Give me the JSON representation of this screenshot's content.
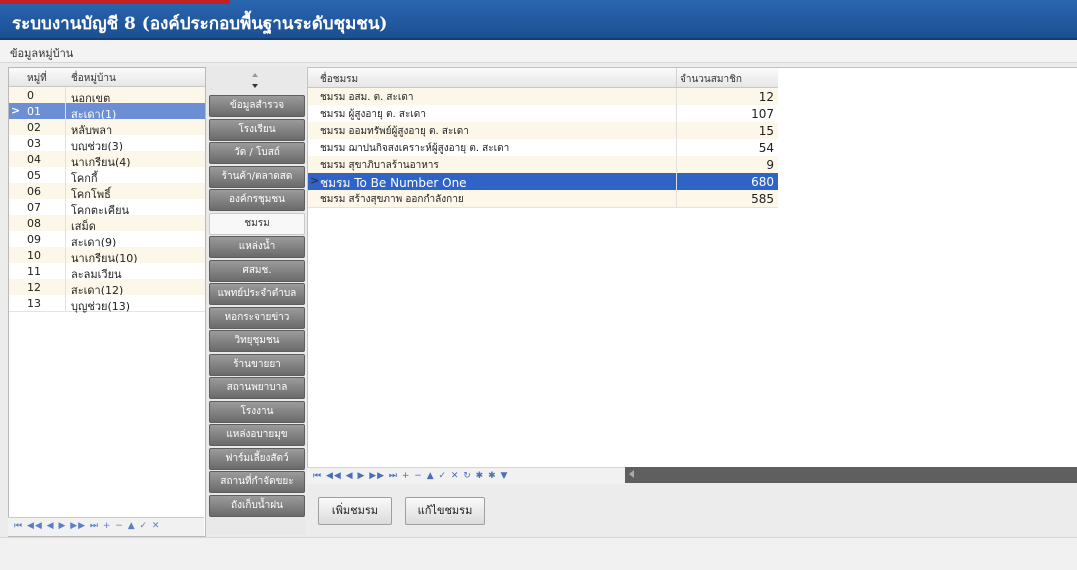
{
  "window": {
    "title": "ระบบงานบัญชี 8 (องค์ประกอบพื้นฐานระดับชุมชน)"
  },
  "menu": {
    "item": "ข้อมูลหมู่บ้าน"
  },
  "villages": {
    "col_no": "หมู่ที่",
    "col_name": "ชื่อหมู่บ้าน",
    "rows": [
      {
        "no": "0",
        "name": "นอกเขต"
      },
      {
        "no": "01",
        "name": "สะเดา(1)"
      },
      {
        "no": "02",
        "name": "หลับพลา"
      },
      {
        "no": "03",
        "name": "บุญช่วย(3)"
      },
      {
        "no": "04",
        "name": "นาเกรียน(4)"
      },
      {
        "no": "05",
        "name": "โคกกี้"
      },
      {
        "no": "06",
        "name": "โคกโพธิ์"
      },
      {
        "no": "07",
        "name": "โคกตะเคียน"
      },
      {
        "no": "08",
        "name": "เสม็ด"
      },
      {
        "no": "09",
        "name": "สะเดา(9)"
      },
      {
        "no": "10",
        "name": "นาเกรียน(10)"
      },
      {
        "no": "11",
        "name": "ละลมเวียน"
      },
      {
        "no": "12",
        "name": "สะเดา(12)"
      },
      {
        "no": "13",
        "name": "บุญช่วย(13)"
      }
    ],
    "selected_index": 1,
    "selected_pointer": ">",
    "nav": "⏮ ◀◀ ◀ ▶ ▶▶ ⏭ + − ▲ ✓ ✕"
  },
  "categories": [
    "ข้อมูลสำรวจ",
    "โรงเรียน",
    "วัด / โบสถ์",
    "ร้านค้า/ตลาดสด",
    "องค์กรชุมชน",
    "ชมรม",
    "แหล่งน้ำ",
    "ศสมช.",
    "แพทย์ประจำตำบล",
    "หอกระจายข่าว",
    "วิทยุชุมชน",
    "ร้านขายยา",
    "สถานพยาบาล",
    "โรงงาน",
    "แหล่งอบายมุข",
    "ฟาร์มเลี้ยงสัตว์",
    "สถานที่กำจัดขยะ",
    "ถังเก็บน้ำฝน"
  ],
  "active_category_index": 5,
  "clubs": {
    "col_name": "ชื่อชมรม",
    "col_count": "จำนวนสมาชิก",
    "rows": [
      {
        "name": "ชมรม อสม. ต. สะเดา",
        "count": "12"
      },
      {
        "name": "ชมรม ผู้สูงอายุ ต. สะเดา",
        "count": "107"
      },
      {
        "name": "ชมรม ออมทรัพย์ผู้สูงอายุ ต. สะเดา",
        "count": "15"
      },
      {
        "name": "ชมรม ฌาปนกิจสงเคราะห์ผู้สูงอายุ ต. สะเดา",
        "count": "54"
      },
      {
        "name": "ชมรม สุขาภิบาลร้านอาหาร",
        "count": "9"
      },
      {
        "name": "ชมรม To Be Number One",
        "count": "680"
      },
      {
        "name": "ชมรม สร้างสุขภาพ ออกกำลังกาย",
        "count": "585"
      }
    ],
    "selected_index": 5,
    "selected_pointer": ">",
    "nav": "⏮ ◀◀ ◀ ▶ ▶▶ ⏭ + − ▲ ✓ ✕ ↻ ✱ ✱ ▼"
  },
  "buttons": {
    "add_club": "เพิ่มชมรม",
    "edit_club": "แก้ไขชมรม"
  },
  "colors": {
    "title_bar": "#1b4f93",
    "selection": "#2f63c5",
    "row_alt": "#fdf7e9",
    "category_button": "#7a7a7a"
  }
}
